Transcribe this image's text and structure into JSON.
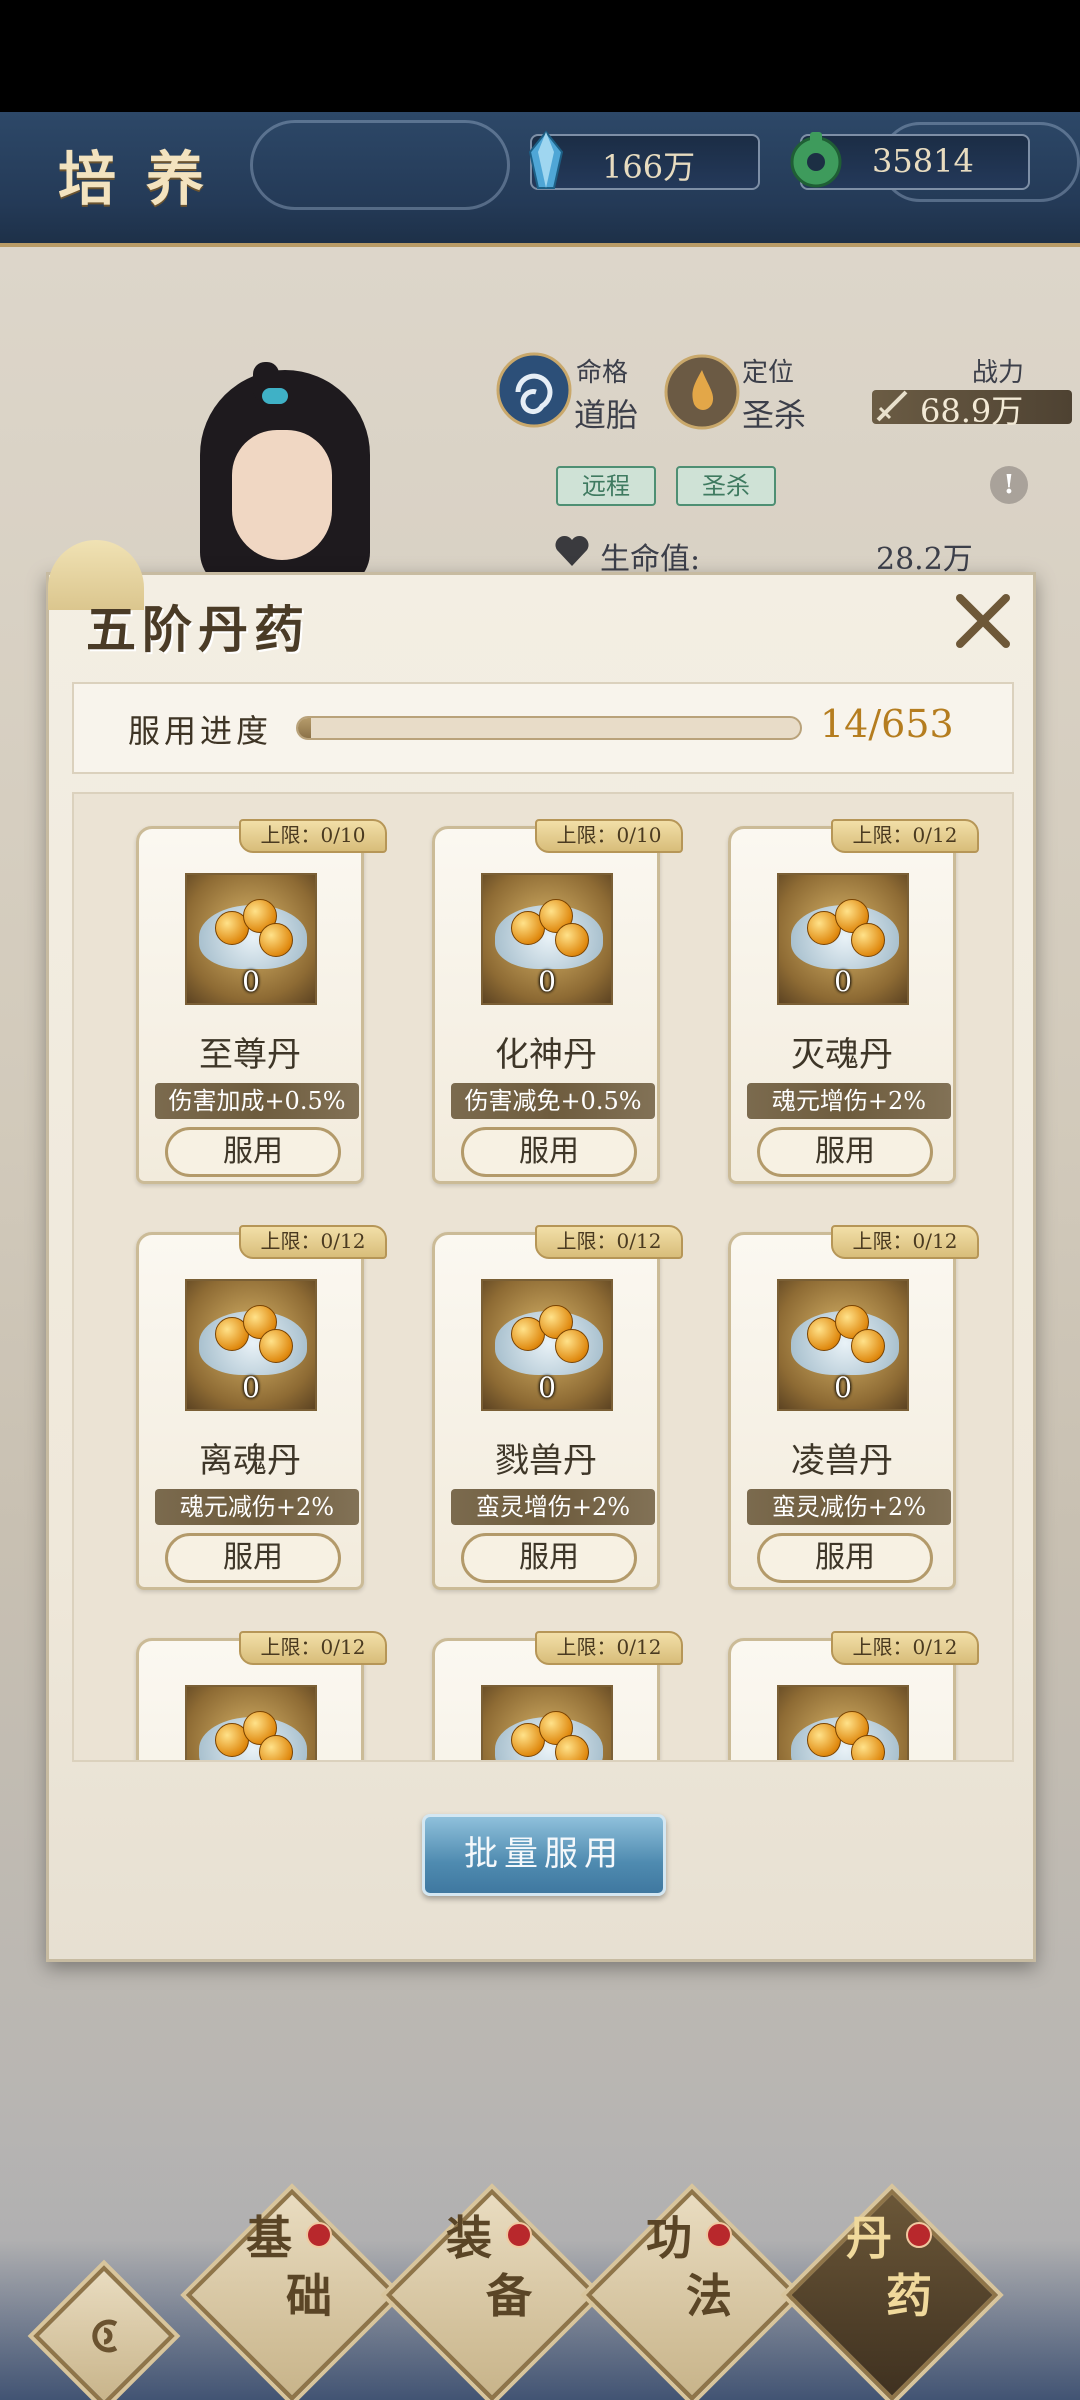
{
  "header": {
    "title": "培养",
    "currency": [
      {
        "name": "crystal",
        "value": "166万",
        "color": "#4fa6d6"
      },
      {
        "name": "jade",
        "value": "35814",
        "color": "#3e9b5c"
      }
    ]
  },
  "stats": {
    "fate_label": "命格",
    "fate_value": "道胎",
    "role_label": "定位",
    "role_value": "圣杀",
    "power_label": "战力",
    "power_value": "68.9万",
    "tags": [
      "远程",
      "圣杀"
    ],
    "hp_label": "生命值:",
    "hp_value": "28.2万"
  },
  "modal": {
    "title": "五阶丹药",
    "progress_label": "服用进度",
    "progress_current": 14,
    "progress_total": 653,
    "progress_text": "14/653",
    "use_label": "服用",
    "batch_label": "批量服用",
    "pills": [
      {
        "name": "至尊丹",
        "cap": "上限：0/10",
        "count": "0",
        "effect": "伤害加成+0.5%"
      },
      {
        "name": "化神丹",
        "cap": "上限：0/10",
        "count": "0",
        "effect": "伤害减免+0.5%"
      },
      {
        "name": "灭魂丹",
        "cap": "上限：0/12",
        "count": "0",
        "effect": "魂元增伤+2%"
      },
      {
        "name": "离魂丹",
        "cap": "上限：0/12",
        "count": "0",
        "effect": "魂元减伤+2%"
      },
      {
        "name": "戮兽丹",
        "cap": "上限：0/12",
        "count": "0",
        "effect": "蛮灵增伤+2%"
      },
      {
        "name": "凌兽丹",
        "cap": "上限：0/12",
        "count": "0",
        "effect": "蛮灵减伤+2%"
      },
      {
        "name": "",
        "cap": "上限：0/12",
        "count": "",
        "effect": ""
      },
      {
        "name": "",
        "cap": "上限：0/12",
        "count": "",
        "effect": ""
      },
      {
        "name": "",
        "cap": "上限：0/12",
        "count": "",
        "effect": ""
      }
    ]
  },
  "nav": {
    "items": [
      {
        "top": "基",
        "bottom": "础",
        "active": false
      },
      {
        "top": "装",
        "bottom": "备",
        "active": false
      },
      {
        "top": "功",
        "bottom": "法",
        "active": false
      },
      {
        "top": "丹",
        "bottom": "药",
        "active": true
      }
    ]
  }
}
